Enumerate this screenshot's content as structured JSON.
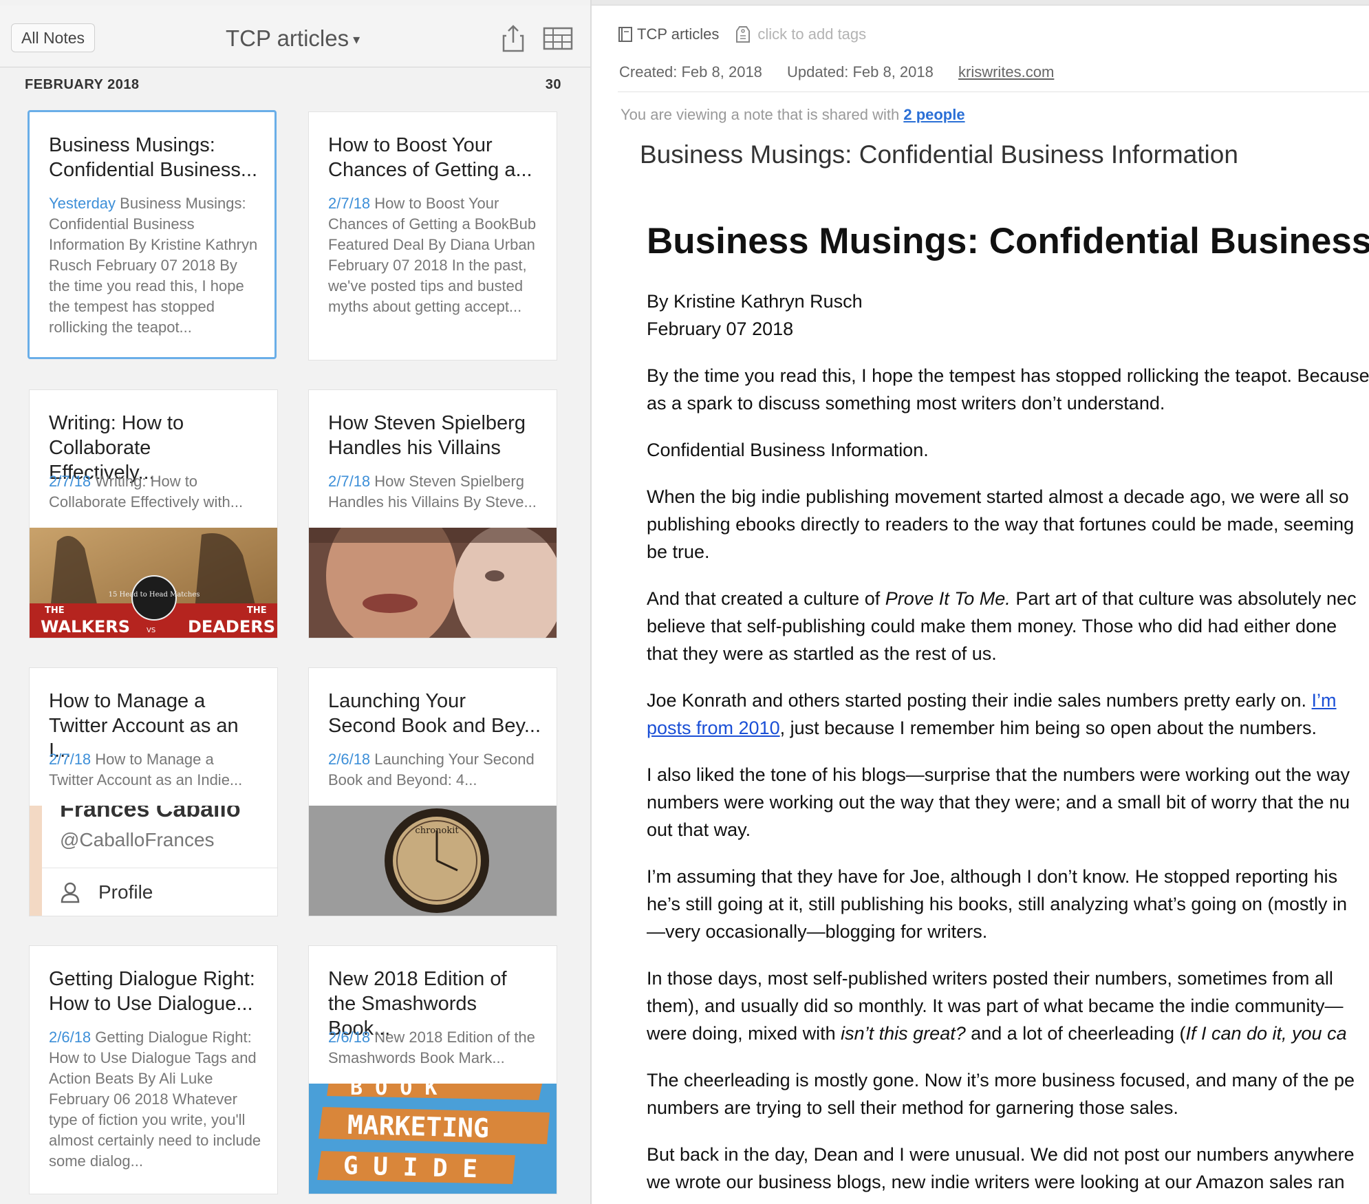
{
  "notes_list": {
    "all_notes_label": "All Notes",
    "notebook_title": "TCP articles",
    "section_header": "FEBRUARY 2018",
    "section_count": "30",
    "cards": [
      {
        "title_line1": "Business Musings:",
        "title_line2": "Confidential Business...",
        "date": "Yesterday",
        "snippet_rest": "Business Musings: Confidential Business Information By Kristine Kathryn Rusch February 07 2018 By the time you read this, I hope the tempest has stopped rollicking the teapot...",
        "selected": true
      },
      {
        "title_line1": "How to Boost Your",
        "title_line2": "Chances of Getting a...",
        "date": "2/7/18",
        "snippet_rest": "How to Boost Your Chances of Getting a BookBub Featured Deal By Diana Urban February 07 2018 In the past, we've posted tips and busted myths about getting accept..."
      },
      {
        "title_line1": "Writing: How to",
        "title_line2": "Collaborate Effectively...",
        "date": "2/7/18",
        "snippet_rest": "Writing: How to Collaborate Effectively with...",
        "thumb_text_left": "WALKERS",
        "thumb_text_vs": "VS",
        "thumb_text_right": "DEADERS",
        "thumb_text_top_left": "THE",
        "thumb_text_top_right": "THE",
        "thumb_badge": "15 Head to Head Matches"
      },
      {
        "title_line1": "How Steven Spielberg",
        "title_line2": "Handles his Villains",
        "date": "2/7/18",
        "snippet_rest": "How Steven Spielberg Handles his Villains By Steve..."
      },
      {
        "title_line1": "How to Manage a",
        "title_line2": "Twitter Account as an I...",
        "date": "2/7/18",
        "snippet_rest": "How to Manage a Twitter Account as an Indie...",
        "thumb_name": "Frances Caballo",
        "thumb_handle": "@CaballoFrances",
        "thumb_profile": "Profile"
      },
      {
        "title_line1": "Launching Your",
        "title_line2": "Second Book and Bey...",
        "date": "2/6/18",
        "snippet_rest": "Launching Your Second Book and Beyond: 4...",
        "thumb_watch_text": "chronokit"
      },
      {
        "title_line1": "Getting Dialogue Right:",
        "title_line2": "How to Use Dialogue...",
        "date": "2/6/18",
        "snippet_rest": "Getting Dialogue Right: How to Use Dialogue Tags and Action Beats By Ali Luke February 06 2018 Whatever type of fiction you write, you'll almost certainly need to include some dialog..."
      },
      {
        "title_line1": "New 2018 Edition of",
        "title_line2": "the Smashwords Book...",
        "date": "2/6/18",
        "snippet_rest": "New 2018 Edition of the Smashwords Book Mark...",
        "thumb_line1": "B O O K",
        "thumb_line2": "MARKETING",
        "thumb_line3": "G U I D E"
      }
    ]
  },
  "note": {
    "notebook": "TCP articles",
    "tags_placeholder": "click to add tags",
    "created": "Created: Feb 8, 2018",
    "updated": "Updated: Feb 8, 2018",
    "source": "kriswrites.com",
    "shared_prefix": "You are viewing a note that is shared with ",
    "shared_link": "2 people",
    "title": "Business Musings: Confidential Business Information",
    "heading": "Business Musings: Confidential Business Information",
    "author": "By Kristine Kathryn Rusch",
    "date": "February 07 2018",
    "p1a": "By the time you read this, I hope the tempest has stopped rollicking the teapot. Because",
    "p1b": "as a spark to discuss something most writers don’t understand.",
    "p2": "Confidential Business Information.",
    "p3a": "When the big indie publishing movement started almost a decade ago, we were all so",
    "p3b": "publishing ebooks directly to readers to the way that fortunes could be made, seeming",
    "p3c": "be true.",
    "p4a_pre": "And that created a culture of ",
    "p4a_em": "Prove It To Me.",
    "p4a_post": " Part art of that culture was absolutely nec",
    "p4b": "believe that self-publishing could make them money. Those who did had either done",
    "p4c": "that they were as startled as the rest of us.",
    "p5a_pre": "Joe Konrath and others started posting their indie sales numbers pretty early on. ",
    "p5a_link": " I’m",
    "p5b_link": "posts from 2010",
    "p5b_post": ", just because I remember him being so open about the numbers.",
    "p6a": "I also liked the tone of his blogs—surprise that the numbers were working out the way",
    "p6b": "numbers were working out the way that they were; and a small bit of worry that the nu",
    "p6c": "out that way.",
    "p7a": "I’m assuming that they have for Joe, although I don’t know. He stopped reporting his",
    "p7b": "he’s still going at it, still publishing his books, still analyzing what’s going on (mostly in",
    "p7c": "—very occasionally—blogging for writers.",
    "p8a": "In those days, most self-published writers posted their numbers, sometimes from all",
    "p8b": "them), and usually did so monthly. It was part of what became the indie community—",
    "p8c_pre": "were doing, mixed with ",
    "p8c_em1": "isn’t this great?",
    "p8c_mid": " and a lot of cheerleading (",
    "p8c_em2": "If I can do it, you ca",
    "p9a": "The cheerleading is mostly gone. Now it’s more business focused, and many of the pe",
    "p9b": "numbers are trying to sell their method for garnering those sales.",
    "p10a": "But back in the day, Dean and I were unusual. We did not post our numbers anywhere",
    "p10b": "we wrote our business blogs, new indie writers were looking at our Amazon sales ran"
  },
  "colors": {
    "accent_blue": "#3d8fd8",
    "link_blue": "#1a4fd6",
    "selected_border": "#6aaee8"
  },
  "icons": [
    "share-icon",
    "grid-view-icon",
    "notebook-icon",
    "tag-icon",
    "chevron-down-icon",
    "profile-icon"
  ]
}
